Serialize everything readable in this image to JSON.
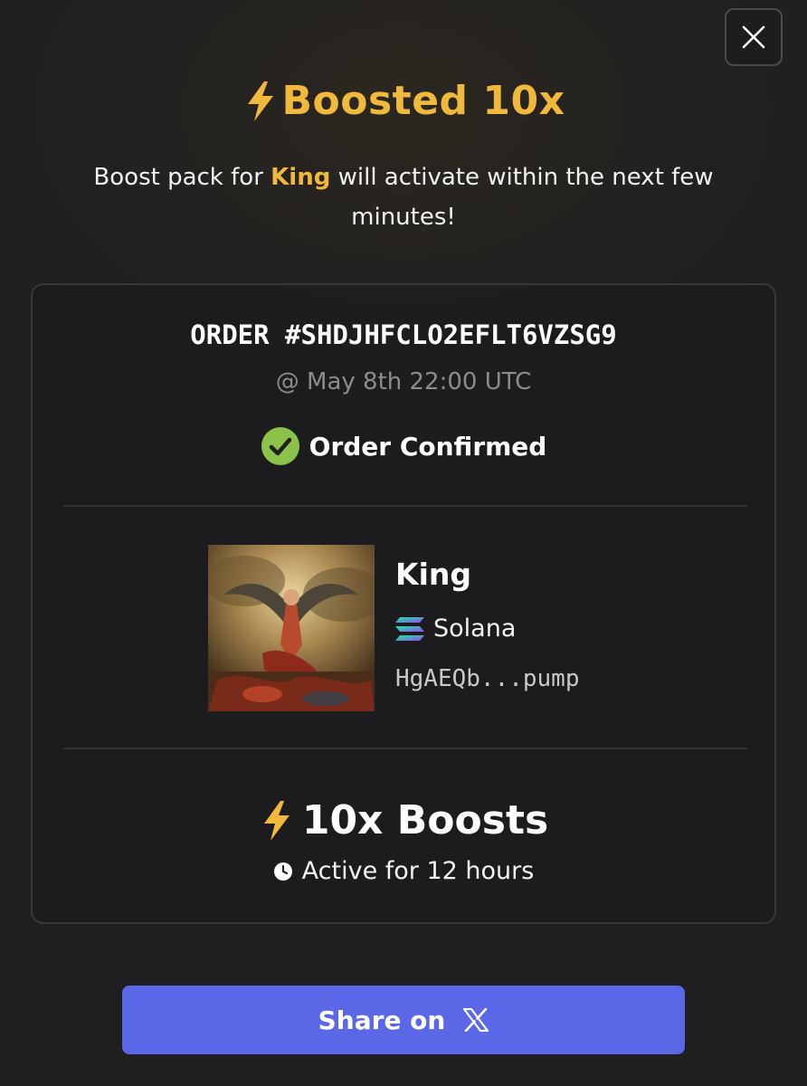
{
  "dialog": {
    "close_icon": "close-icon",
    "title_icon": "lightning-icon",
    "title": "Boosted 10x",
    "subtitle_before": "Boost pack for ",
    "subtitle_token": "King",
    "subtitle_after": " will activate within the next few minutes!"
  },
  "order": {
    "id": "ORDER #SHDJHFCLO2EFLT6VZSG9",
    "timestamp": "@ May 8th 22:00 UTC",
    "status": "Order Confirmed",
    "status_icon": "check-circle-icon",
    "status_color": "#8bc34a"
  },
  "token": {
    "image": "token-artwork",
    "name": "King",
    "chain": "Solana",
    "chain_icon": "solana-icon",
    "address": "HgAEQb...pump"
  },
  "boost": {
    "icon": "lightning-icon",
    "label": "10x Boosts",
    "duration_icon": "clock-icon",
    "duration": "Active for 12 hours"
  },
  "share": {
    "label": "Share on",
    "icon": "x-logo-icon"
  },
  "colors": {
    "accent": "#f1b93c",
    "button": "#5a67e6",
    "background": "#222120"
  }
}
